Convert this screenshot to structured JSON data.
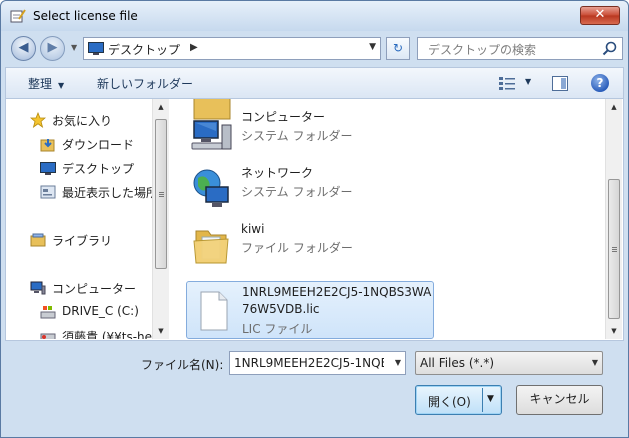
{
  "window": {
    "title": "Select license file",
    "close_label": "✕"
  },
  "nav": {
    "back_arrow": "◀",
    "forward_arrow": "▶",
    "address": "デスクトップ",
    "address_separator": "▶",
    "search_placeholder": "デスクトップの検索"
  },
  "toolbar": {
    "organize_label": "整理",
    "new_folder_label": "新しいフォルダー"
  },
  "navpane": {
    "items": [
      {
        "label": "お気に入り",
        "icon": "star-icon"
      },
      {
        "label": "ダウンロード",
        "icon": "downloads-folder-icon"
      },
      {
        "label": "デスクトップ",
        "icon": "desktop-icon"
      },
      {
        "label": "最近表示した場所",
        "icon": "recent-places-icon"
      },
      {
        "label": "ライブラリ",
        "icon": "library-icon"
      },
      {
        "label": "コンピューター",
        "icon": "computer-icon"
      },
      {
        "label": "DRIVE_C (C:)",
        "icon": "drive-icon"
      },
      {
        "label": "須藤貴 (¥¥ts-he",
        "icon": "network-drive-icon"
      }
    ]
  },
  "files": {
    "items": [
      {
        "name": "コンピューター",
        "type": "システム フォルダー",
        "icon": "computer-icon"
      },
      {
        "name": "ネットワーク",
        "type": "システム フォルダー",
        "icon": "network-icon"
      },
      {
        "name": "kiwi",
        "type": "ファイル フォルダー",
        "icon": "folder-icon"
      },
      {
        "name": "1NRL9MEEH2E2CJ5-1NQBS3WA76W5VDB.lic",
        "type": "LIC ファイル",
        "icon": "file-icon",
        "selected": true
      }
    ]
  },
  "footer": {
    "filename_label": "ファイル名(N):",
    "filename_value": "1NRL9MEEH2E2CJ5-1NQB",
    "filter_value": "All Files (*.*)",
    "open_label": "開く(O)",
    "cancel_label": "キャンセル"
  },
  "colors": {
    "accent": "#3c7fb1",
    "selection": "#cfe4fa"
  }
}
